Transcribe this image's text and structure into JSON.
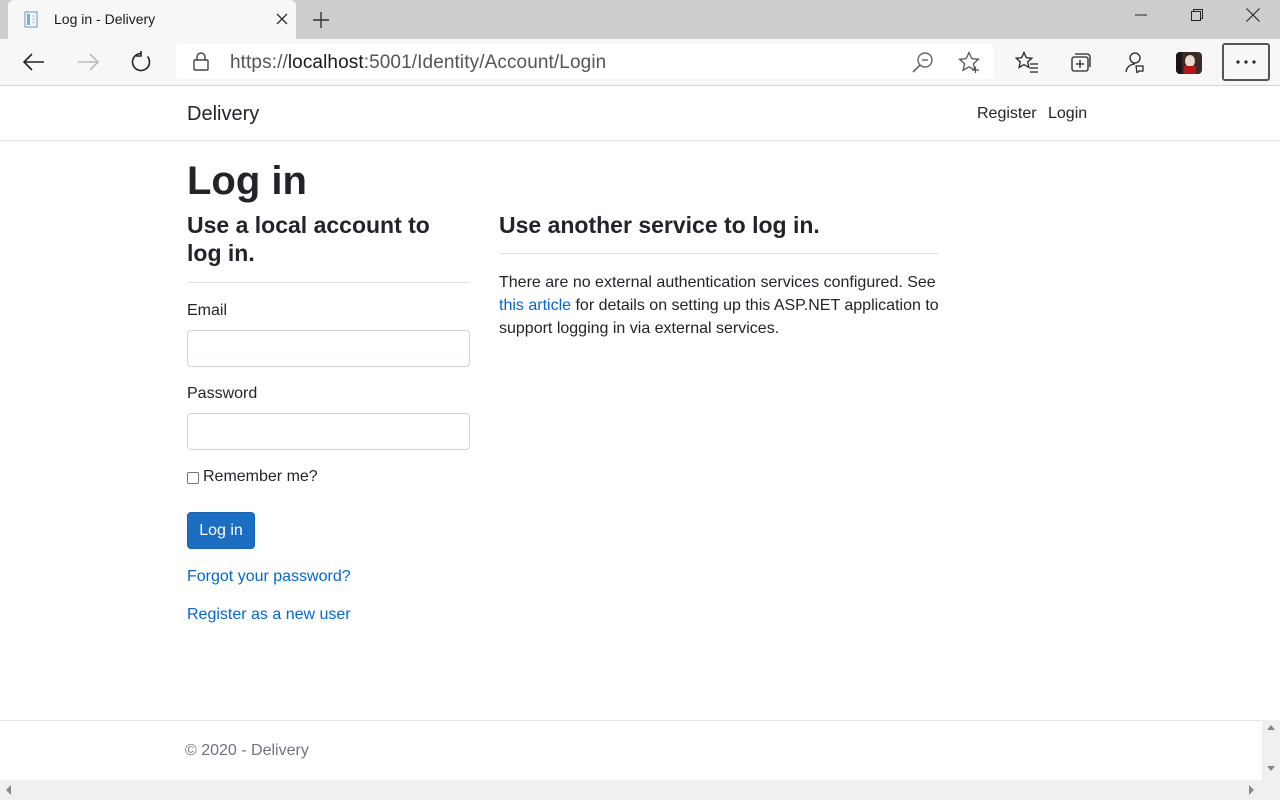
{
  "browser": {
    "tab_title": "Log in - Delivery",
    "url_scheme": "https://",
    "url_host": "localhost",
    "url_rest": ":5001/Identity/Account/Login"
  },
  "site": {
    "brand": "Delivery",
    "nav": {
      "register": "Register",
      "login": "Login"
    }
  },
  "page": {
    "title": "Log in",
    "local_heading": "Use a local account to log in.",
    "email_label": "Email",
    "email_value": "",
    "password_label": "Password",
    "password_value": "",
    "remember_label": "Remember me?",
    "login_button": "Log in",
    "forgot_link": "Forgot your password?",
    "register_link": "Register as a new user",
    "external_heading": "Use another service to log in.",
    "external_text_before": "There are no external authentication services configured. See ",
    "external_link": "this article",
    "external_text_after": " for details on setting up this ASP.NET application to support logging in via external services."
  },
  "footer": {
    "text": "© 2020 - Delivery"
  },
  "colors": {
    "link": "#0366d6",
    "primary_button": "#1b6ec2"
  }
}
